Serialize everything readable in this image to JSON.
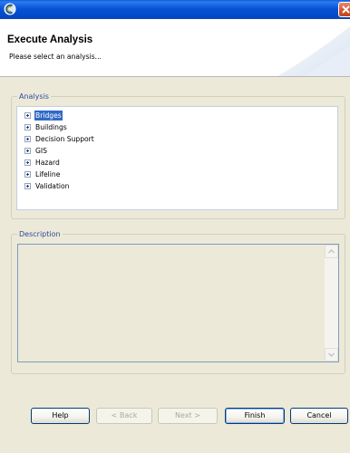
{
  "header": {
    "title": "Execute Analysis",
    "message": "Please select an analysis..."
  },
  "analysis_group": {
    "label": "Analysis",
    "items": [
      {
        "label": "Bridges",
        "selected": true
      },
      {
        "label": "Buildings",
        "selected": false
      },
      {
        "label": "Decision Support",
        "selected": false
      },
      {
        "label": "GIS",
        "selected": false
      },
      {
        "label": "Hazard",
        "selected": false
      },
      {
        "label": "Lifeline",
        "selected": false
      },
      {
        "label": "Validation",
        "selected": false
      }
    ]
  },
  "description_group": {
    "label": "Description",
    "text": ""
  },
  "buttons": {
    "help": "Help",
    "back": "< Back",
    "next": "Next >",
    "finish": "Finish",
    "cancel": "Cancel"
  },
  "colors": {
    "titlebar": "#0854d6",
    "selection": "#316ac5",
    "group_label": "#2c4b9c",
    "dialog_bg": "#ece9d8"
  },
  "icons": {
    "app": "eclipse-app-icon",
    "close": "close-icon",
    "expand": "plus-expander-icon"
  }
}
